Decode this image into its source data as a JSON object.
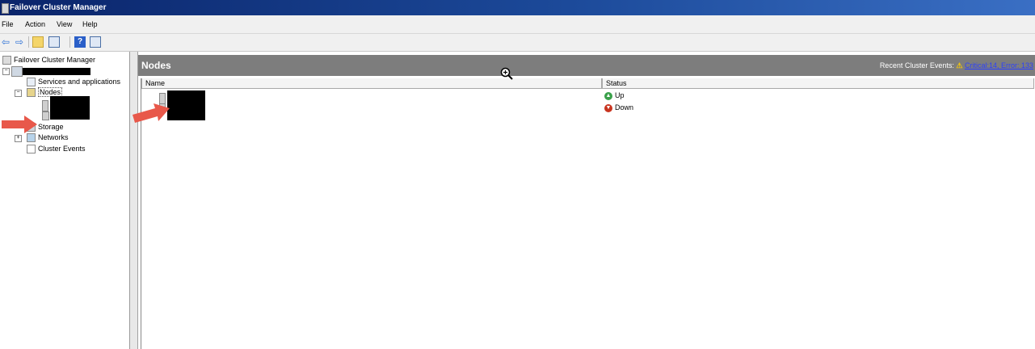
{
  "window": {
    "title": "Failover Cluster Manager"
  },
  "menu": [
    "File",
    "Action",
    "View",
    "Help"
  ],
  "toolbar": {
    "buttons": [
      "back-icon",
      "forward-icon",
      "up-folder-icon",
      "show-hide-console-tree-icon",
      "help-icon",
      "show-hide-action-pane-icon"
    ]
  },
  "tree": {
    "root": "Failover Cluster Manager",
    "services": "Services and applications",
    "nodes": "Nodes",
    "storage": "Storage",
    "networks": "Networks",
    "events": "Cluster Events"
  },
  "main": {
    "title": "Nodes",
    "events_label": "Recent Cluster Events:",
    "events_link": "Critical:14, Error: 133",
    "columns": [
      "Name",
      "Status"
    ],
    "rows": [
      {
        "status": "Up",
        "status_color": "#3aa04a"
      },
      {
        "status": "Down",
        "status_color": "#c8341f"
      }
    ]
  },
  "colors": {
    "accent_arrow": "#e8584a",
    "header_bg": "#7d7d7d",
    "title_bar": "#0a246a"
  }
}
